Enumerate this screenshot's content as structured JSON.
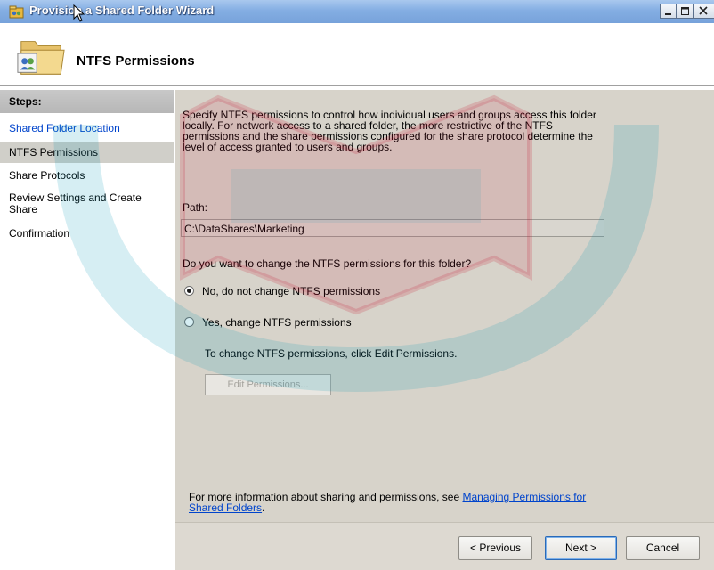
{
  "window": {
    "title": "Provision a Shared Folder Wizard",
    "controls": {
      "minimize": "minimize-icon",
      "maximize": "maximize-icon",
      "close": "close-icon"
    }
  },
  "header": {
    "title": "NTFS Permissions",
    "icon": "shared-folder-icon"
  },
  "steps": {
    "title": "Steps:",
    "items": [
      {
        "label": "Shared Folder Location",
        "state": "link"
      },
      {
        "label": "NTFS Permissions",
        "state": "active"
      },
      {
        "label": "Share Protocols",
        "state": "normal"
      },
      {
        "label": "Review Settings and Create Share",
        "state": "normal"
      },
      {
        "label": "Confirmation",
        "state": "normal"
      }
    ]
  },
  "main": {
    "intro": "Specify NTFS permissions to control how individual users and groups access this folder locally. For network access to a shared folder, the more restrictive of the NTFS permissions and the share permissions configured for the share protocol determine the level of access granted to users and groups.",
    "path_label": "Path:",
    "path_value": "C:\\DataShares\\Marketing",
    "question": "Do you want to change the NTFS permissions for this folder?",
    "options": [
      {
        "label": "No, do not change NTFS permissions",
        "selected": true
      },
      {
        "label": "Yes, change NTFS permissions",
        "selected": false
      }
    ],
    "change_hint": "To change NTFS permissions, click Edit Permissions.",
    "edit_button": "Edit Permissions...",
    "more_info_prefix": "For more information about sharing and permissions, see ",
    "more_info_link": "Managing Permissions for Shared Folders",
    "more_info_suffix": "."
  },
  "buttons": {
    "previous": "< Previous",
    "next": "Next >",
    "cancel": "Cancel"
  },
  "colors": {
    "titlebar": "#84aee3",
    "link": "#0044cc",
    "main_bg": "#d7d3ca",
    "watermark_red": "#c8102e",
    "watermark_teal": "#0096b4"
  }
}
